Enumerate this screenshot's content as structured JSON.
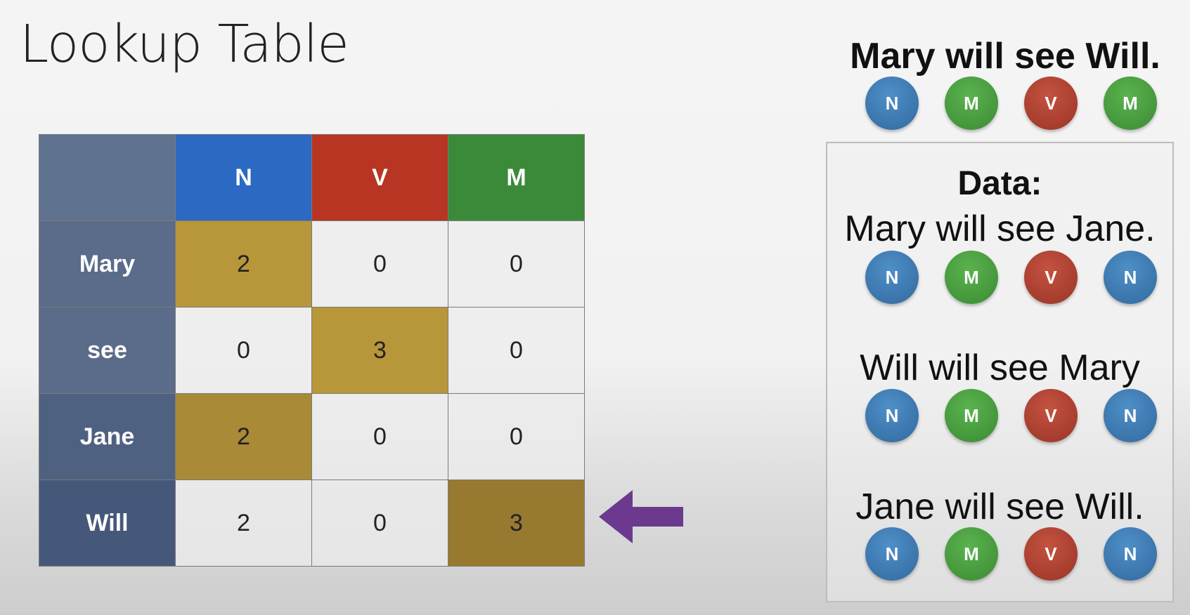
{
  "title": "Lookup Table",
  "table": {
    "columns": [
      "N",
      "V",
      "M"
    ],
    "column_colors": [
      "#2b69c2",
      "#b73522",
      "#3b8a3a"
    ],
    "rows": [
      {
        "word": "Mary",
        "values": [
          "2",
          "0",
          "0"
        ],
        "highlight": 0
      },
      {
        "word": "see",
        "values": [
          "0",
          "3",
          "0"
        ],
        "highlight": 1
      },
      {
        "word": "Jane",
        "values": [
          "2",
          "0",
          "0"
        ],
        "highlight": 0
      },
      {
        "word": "Will",
        "values": [
          "2",
          "0",
          "3"
        ],
        "highlight": 2
      }
    ],
    "highlight_color": "#b8963a"
  },
  "arrow": {
    "icon": "left-arrow-icon",
    "color": "#6b3a8e"
  },
  "target": {
    "sentence": "Mary will see Will.",
    "tags": [
      "N",
      "M",
      "V",
      "M"
    ]
  },
  "data": {
    "heading": "Data:",
    "examples": [
      {
        "sentence": "Mary will see Jane.",
        "tags": [
          "N",
          "M",
          "V",
          "N"
        ]
      },
      {
        "sentence": "Will will see Mary",
        "tags": [
          "N",
          "M",
          "V",
          "N"
        ]
      },
      {
        "sentence": "Jane will see Will.",
        "tags": [
          "N",
          "M",
          "V",
          "N"
        ]
      }
    ]
  },
  "tag_colors": {
    "N": "#3a78b2",
    "M": "#49a03f",
    "V": "#b04131"
  }
}
